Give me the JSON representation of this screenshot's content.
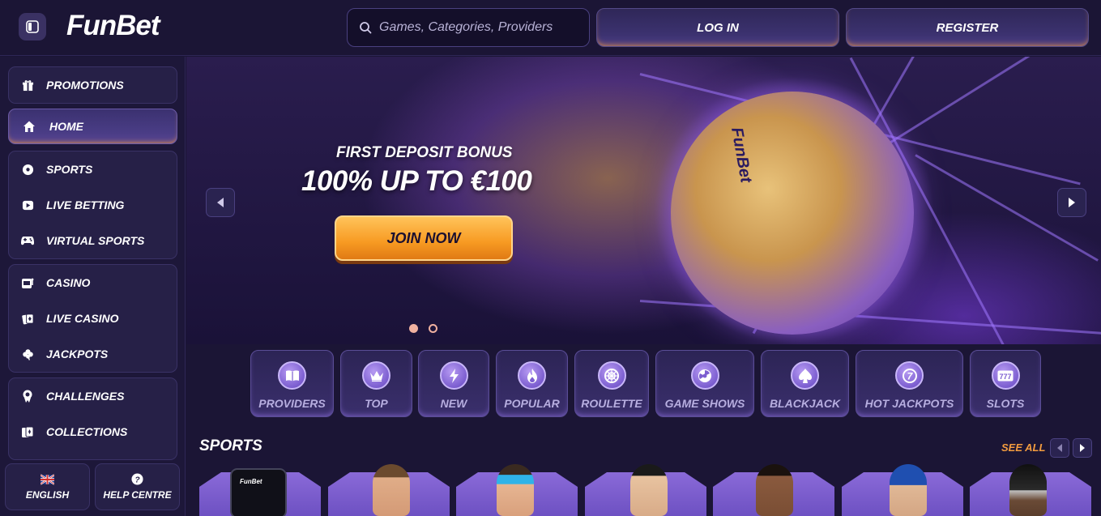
{
  "header": {
    "logo": "FunBet",
    "search_placeholder": "Games, Categories, Providers",
    "login_label": "LOG IN",
    "register_label": "REGISTER"
  },
  "sidebar": {
    "promotions": "PROMOTIONS",
    "home": "HOME",
    "sports_group": [
      "SPORTS",
      "LIVE BETTING",
      "VIRTUAL SPORTS"
    ],
    "casino_group": [
      "CASINO",
      "LIVE CASINO",
      "JACKPOTS"
    ],
    "extra_group": [
      "CHALLENGES",
      "COLLECTIONS"
    ],
    "language_label": "ENGLISH",
    "help_label": "HELP CENTRE"
  },
  "hero": {
    "subtitle": "FIRST DEPOSIT BONUS",
    "title": "100% UP TO €100",
    "cta": "JOIN NOW",
    "ball_brand": "FunBet",
    "slides_total": 2,
    "active_slide": 1
  },
  "categories": [
    {
      "label": "PROVIDERS",
      "icon": "book-icon"
    },
    {
      "label": "TOP",
      "icon": "crown-icon"
    },
    {
      "label": "NEW",
      "icon": "lightning-icon"
    },
    {
      "label": "POPULAR",
      "icon": "flame-icon"
    },
    {
      "label": "ROULETTE",
      "icon": "roulette-icon"
    },
    {
      "label": "GAME SHOWS",
      "icon": "wheel-icon"
    },
    {
      "label": "BLACKJACK",
      "icon": "spade-icon"
    },
    {
      "label": "HOT JACKPOTS",
      "icon": "jackpot-coin-icon"
    },
    {
      "label": "SLOTS",
      "icon": "slot-777-icon"
    }
  ],
  "sports_section": {
    "title": "SPORTS",
    "see_all": "SEE ALL",
    "phone_brand": "FunBet"
  },
  "colors": {
    "background": "#1b1535",
    "accent_orange": "#f39c3f",
    "accent_purple": "#7c5ed0"
  }
}
